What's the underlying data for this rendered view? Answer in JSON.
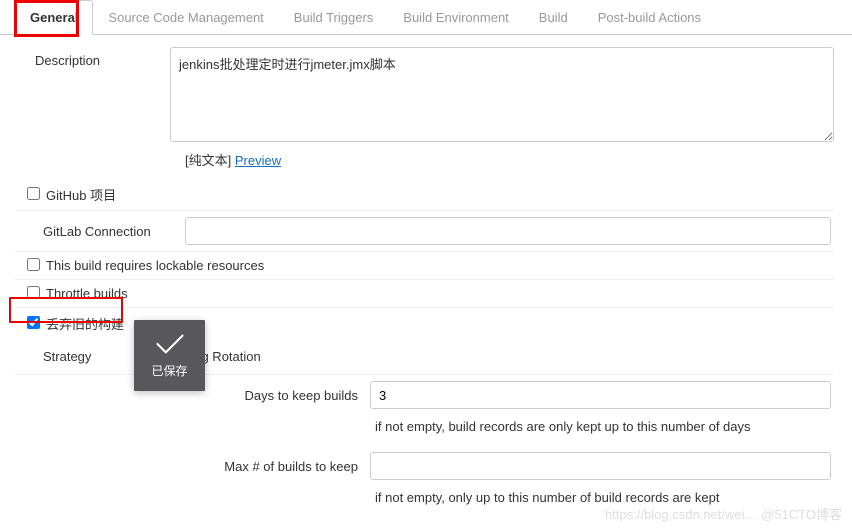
{
  "tabs": {
    "general": "General",
    "scm": "Source Code Management",
    "triggers": "Build Triggers",
    "env": "Build Environment",
    "build": "Build",
    "postbuild": "Post-build Actions"
  },
  "description": {
    "label": "Description",
    "value": "jenkins批处理定时进行jmeter.jmx脚本",
    "plain": "[纯文本] ",
    "previewLink": "Preview"
  },
  "github": {
    "label": "GitHub 项目",
    "checked": false
  },
  "gitlab": {
    "label": "GitLab Connection",
    "value": ""
  },
  "lockable": {
    "label": "This build requires lockable resources",
    "checked": false
  },
  "throttle": {
    "label": "Throttle builds",
    "checked": false
  },
  "discard": {
    "label": "丢弃旧的构建",
    "checked": true
  },
  "strategy": {
    "label": "Strategy",
    "value": "Log Rotation"
  },
  "daysToKeep": {
    "label": "Days to keep builds",
    "value": "3",
    "hint": "if not empty, build records are only kept up to this number of days"
  },
  "maxBuilds": {
    "label": "Max # of builds to keep",
    "value": "",
    "hint": "if not empty, only up to this number of build records are kept"
  },
  "toast": {
    "text": "已保存"
  },
  "watermark": "https://blog.csdn.net/wei…  @51CTO博客"
}
